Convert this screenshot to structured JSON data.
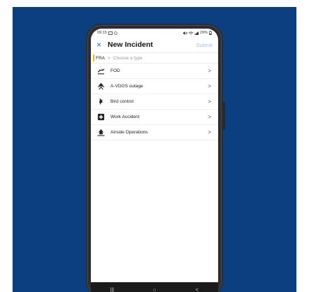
{
  "status_bar": {
    "time": "09:15",
    "battery": "29%"
  },
  "header": {
    "close_icon": "×",
    "title": "New Incident",
    "submit_label": "Submit"
  },
  "breadcrumb": {
    "code": "FRA",
    "separator": ">",
    "hint": "Choose a type"
  },
  "incident_types": [
    {
      "label": "FOD",
      "icon": "fod-icon"
    },
    {
      "label": "A-VDGS outage",
      "icon": "vdgs-icon"
    },
    {
      "label": "Bird control",
      "icon": "bird-icon"
    },
    {
      "label": "Work Accident",
      "icon": "first-aid-icon"
    },
    {
      "label": "Airside Operations",
      "icon": "aircraft-icon"
    }
  ],
  "chevron": ">",
  "nav": {
    "recents": "|||",
    "home": "○",
    "back": "<"
  },
  "colors": {
    "background": "#0b3f80",
    "accent": "#1a73c8",
    "breadcrumb_marker": "#f2b21c",
    "submit_disabled": "#9dc3e6"
  }
}
